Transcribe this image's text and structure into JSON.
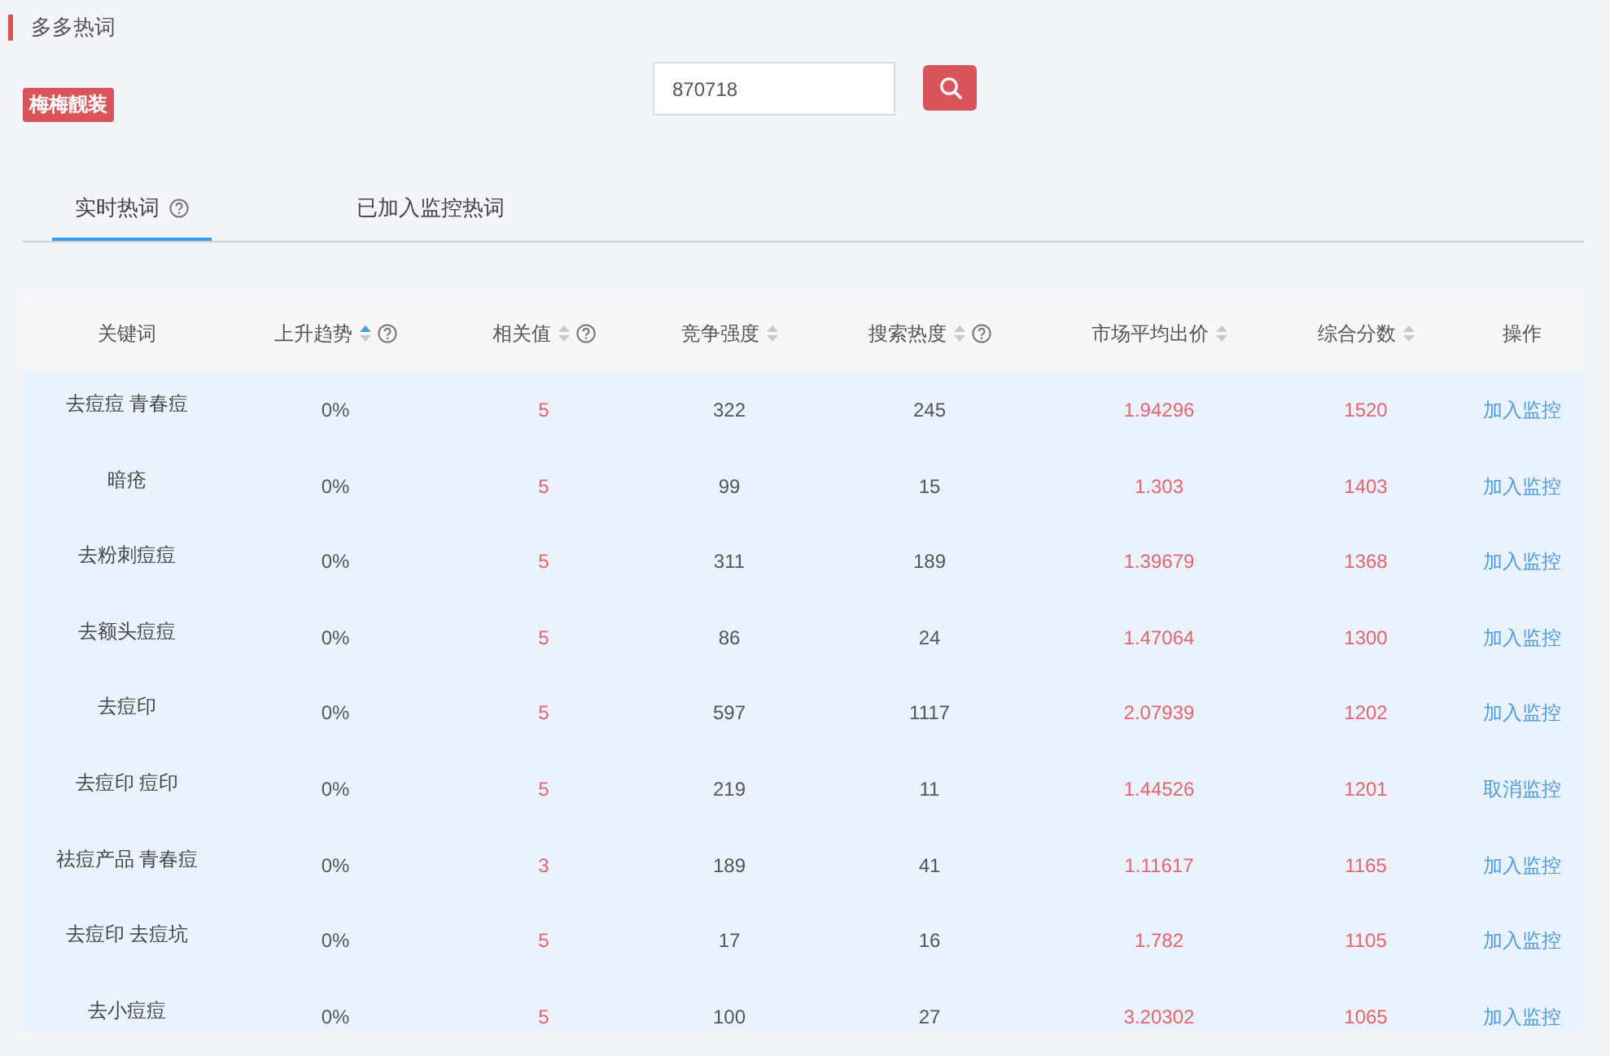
{
  "section_title": "多多热词",
  "shop_tag": "梅梅靓装",
  "search": {
    "value": "870718"
  },
  "tabs": [
    {
      "label": "实时热词",
      "help": true,
      "selected": true
    },
    {
      "label": "已加入监控热词",
      "help": false,
      "selected": false
    }
  ],
  "table": {
    "columns": [
      {
        "label": "关键词",
        "sortable": false,
        "sorted": false,
        "help": false
      },
      {
        "label": "上升趋势",
        "sortable": true,
        "sorted": true,
        "help": true
      },
      {
        "label": "相关值",
        "sortable": true,
        "sorted": false,
        "help": true
      },
      {
        "label": "竞争强度",
        "sortable": true,
        "sorted": false,
        "help": false
      },
      {
        "label": "搜索热度",
        "sortable": true,
        "sorted": false,
        "help": true
      },
      {
        "label": "市场平均出价",
        "sortable": true,
        "sorted": false,
        "help": false
      },
      {
        "label": "综合分数",
        "sortable": true,
        "sorted": false,
        "help": false
      },
      {
        "label": "操作",
        "sortable": false,
        "sorted": false,
        "help": false
      }
    ],
    "rows": [
      {
        "keyword": "去痘痘 青春痘",
        "trend": "0%",
        "relevance": "5",
        "competition": "322",
        "search_heat": "245",
        "avg_bid": "1.94296",
        "score": "1520",
        "action": "加入监控"
      },
      {
        "keyword": "暗疮",
        "trend": "0%",
        "relevance": "5",
        "competition": "99",
        "search_heat": "15",
        "avg_bid": "1.303",
        "score": "1403",
        "action": "加入监控"
      },
      {
        "keyword": "去粉刺痘痘",
        "trend": "0%",
        "relevance": "5",
        "competition": "311",
        "search_heat": "189",
        "avg_bid": "1.39679",
        "score": "1368",
        "action": "加入监控"
      },
      {
        "keyword": "去额头痘痘",
        "trend": "0%",
        "relevance": "5",
        "competition": "86",
        "search_heat": "24",
        "avg_bid": "1.47064",
        "score": "1300",
        "action": "加入监控"
      },
      {
        "keyword": "去痘印",
        "trend": "0%",
        "relevance": "5",
        "competition": "597",
        "search_heat": "1117",
        "avg_bid": "2.07939",
        "score": "1202",
        "action": "加入监控"
      },
      {
        "keyword": "去痘印 痘印",
        "trend": "0%",
        "relevance": "5",
        "competition": "219",
        "search_heat": "11",
        "avg_bid": "1.44526",
        "score": "1201",
        "action": "取消监控"
      },
      {
        "keyword": "祛痘产品 青春痘",
        "trend": "0%",
        "relevance": "3",
        "competition": "189",
        "search_heat": "41",
        "avg_bid": "1.11617",
        "score": "1165",
        "action": "加入监控"
      },
      {
        "keyword": "去痘印 去痘坑",
        "trend": "0%",
        "relevance": "5",
        "competition": "17",
        "search_heat": "16",
        "avg_bid": "1.782",
        "score": "1105",
        "action": "加入监控"
      },
      {
        "keyword": "去小痘痘",
        "trend": "0%",
        "relevance": "5",
        "competition": "100",
        "search_heat": "27",
        "avg_bid": "3.20302",
        "score": "1065",
        "action": "加入监控"
      }
    ]
  }
}
